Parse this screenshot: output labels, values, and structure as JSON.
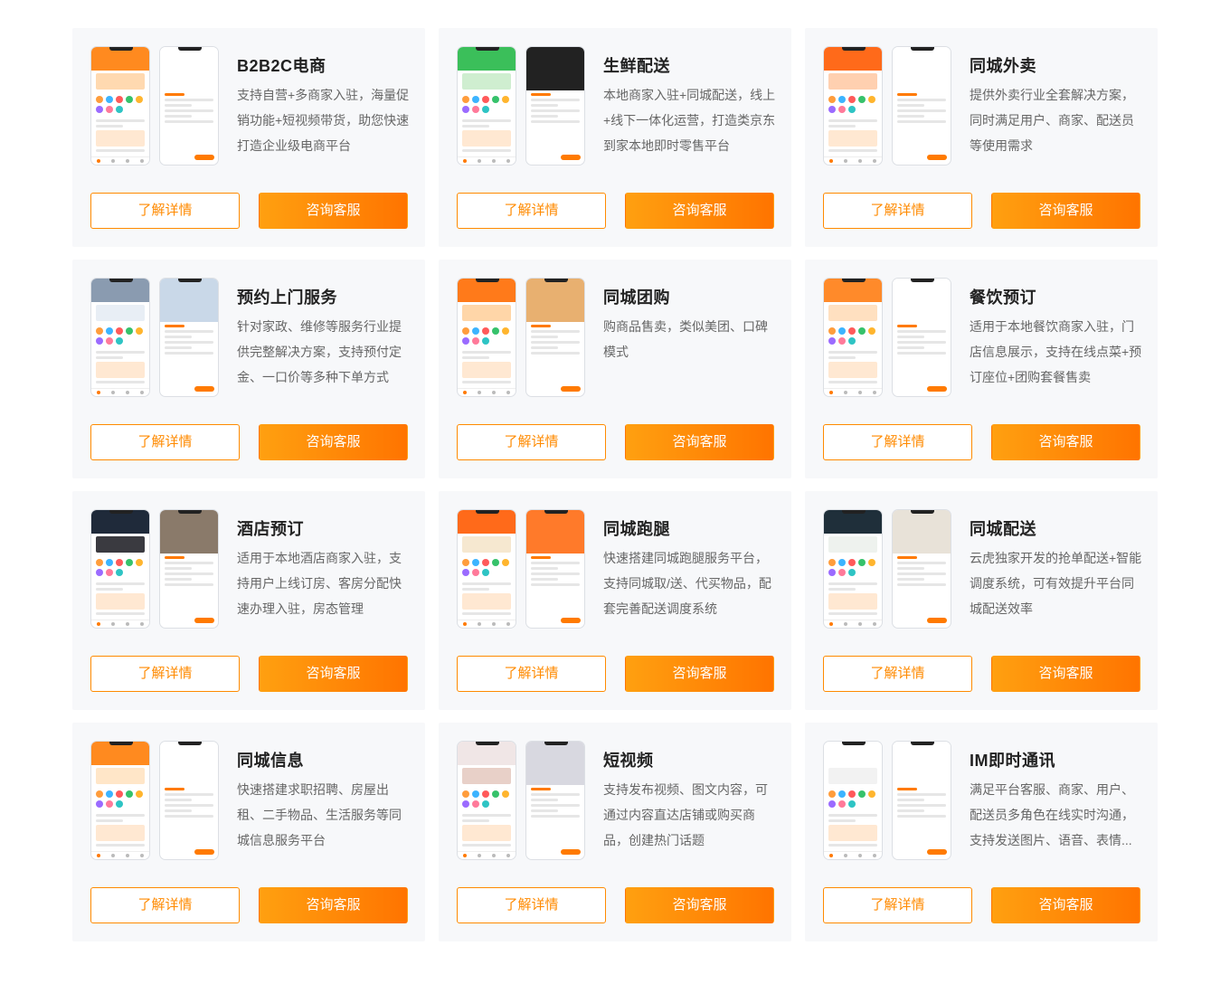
{
  "buttons": {
    "detail": "了解详情",
    "consult": "咨询客服"
  },
  "cards": [
    {
      "title": "B2B2C电商",
      "desc": "支持自营+多商家入驻，海量促销功能+短视频带货，助您快速打造企业级电商平台"
    },
    {
      "title": "生鲜配送",
      "desc": "本地商家入驻+同城配送，线上+线下一体化运营，打造类京东到家本地即时零售平台"
    },
    {
      "title": "同城外卖",
      "desc": "提供外卖行业全套解决方案，同时满足用户、商家、配送员等使用需求"
    },
    {
      "title": "预约上门服务",
      "desc": "针对家政、维修等服务行业提供完整解决方案，支持预付定金、一口价等多种下单方式"
    },
    {
      "title": "同城团购",
      "desc": "购商品售卖，类似美团、口碑模式"
    },
    {
      "title": "餐饮预订",
      "desc": "适用于本地餐饮商家入驻，门店信息展示，支持在线点菜+预订座位+团购套餐售卖"
    },
    {
      "title": "酒店预订",
      "desc": "适用于本地酒店商家入驻，支持用户上线订房、客房分配快速办理入驻，房态管理"
    },
    {
      "title": "同城跑腿",
      "desc": "快速搭建同城跑腿服务平台，支持同城取/送、代买物品，配套完善配送调度系统"
    },
    {
      "title": "同城配送",
      "desc": "云虎独家开发的抢单配送+智能调度系统，可有效提升平台同城配送效率"
    },
    {
      "title": "同城信息",
      "desc": "快速搭建求职招聘、房屋出租、二手物品、生活服务等同城信息服务平台"
    },
    {
      "title": "短视频",
      "desc": "支持发布视频、图文内容，可通过内容直达店铺或购买商品，创建热门话题"
    },
    {
      "title": "IM即时通讯",
      "desc": "满足平台客服、商家、用户、配送员多角色在线实时沟通，支持发送图片、语音、表情..."
    }
  ],
  "accent": {
    "orange": "#ff8a00",
    "gradient_start": "#ffa010",
    "gradient_end": "#ff7400",
    "card_bg": "#f7f8fa"
  }
}
